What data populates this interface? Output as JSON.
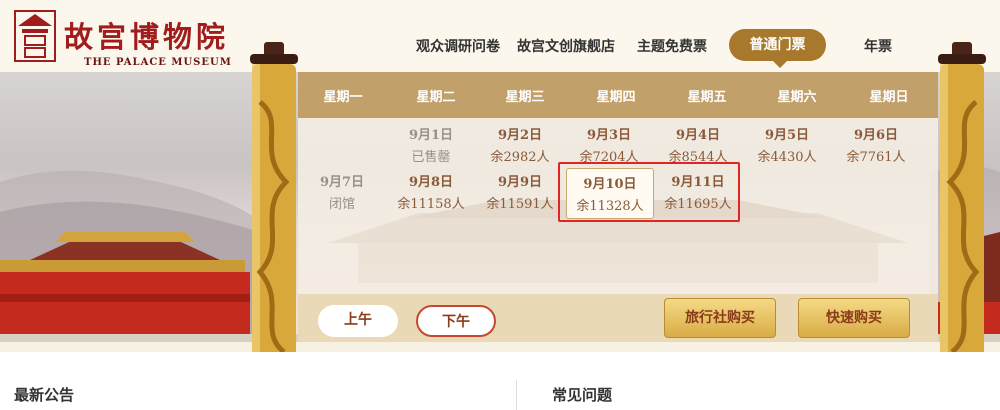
{
  "header": {
    "logo_text": "故宫博物院",
    "logo_subtitle": "THE PALACE MUSEUM",
    "nav": [
      {
        "label": "观众调研问卷"
      },
      {
        "label": "故宫文创旗舰店"
      },
      {
        "label": "主题免费票"
      },
      {
        "label": "普通门票"
      },
      {
        "label": "年票"
      }
    ]
  },
  "calendar": {
    "weekdays": [
      "星期一",
      "星期二",
      "星期三",
      "星期四",
      "星期五",
      "星期六",
      "星期日"
    ],
    "week1": [
      {
        "date": "9月1日",
        "remain": "已售罄"
      },
      {
        "date": "9月2日",
        "remain": "余2982人"
      },
      {
        "date": "9月3日",
        "remain": "余7204人"
      },
      {
        "date": "9月4日",
        "remain": "余8544人"
      },
      {
        "date": "9月5日",
        "remain": "余4430人"
      },
      {
        "date": "9月6日",
        "remain": "余7761人"
      }
    ],
    "week2": [
      {
        "date": "9月7日",
        "remain": "闭馆"
      },
      {
        "date": "9月8日",
        "remain": "余11158人"
      },
      {
        "date": "9月9日",
        "remain": "余11591人"
      },
      {
        "date": "9月10日",
        "remain": "余11328人"
      },
      {
        "date": "9月11日",
        "remain": "余11695人"
      }
    ],
    "selected_date": "9月10日"
  },
  "session": {
    "am_label": "上午",
    "pm_label": "下午",
    "selected": "下午"
  },
  "buttons": {
    "travel_agency": "旅行社购买",
    "quick_buy": "快速购买"
  },
  "footer": {
    "announcements_title": "最新公告",
    "faq_title": "常见问题"
  },
  "colors": {
    "brand_red": "#a11d1d",
    "gold": "#a8792c",
    "highlight_red": "#e02525"
  }
}
